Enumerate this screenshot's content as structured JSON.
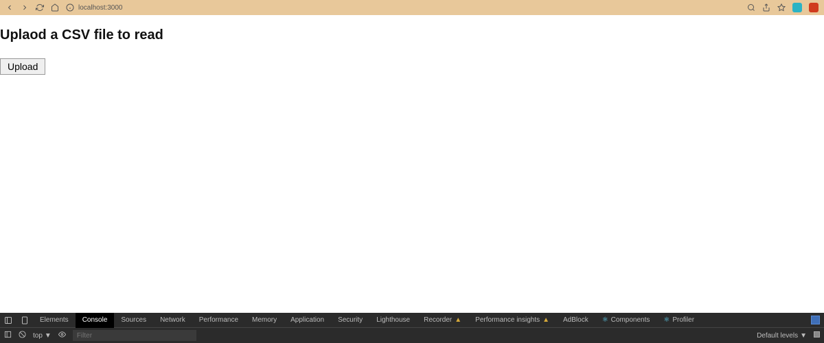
{
  "browser": {
    "url": "localhost:3000"
  },
  "page": {
    "heading": "Uplaod a CSV file to read",
    "upload_button": "Upload"
  },
  "devtools": {
    "tabs": {
      "elements": "Elements",
      "console": "Console",
      "sources": "Sources",
      "network": "Network",
      "performance": "Performance",
      "memory": "Memory",
      "application": "Application",
      "security": "Security",
      "lighthouse": "Lighthouse",
      "recorder": "Recorder",
      "performance_insights": "Performance insights",
      "adblock": "AdBlock",
      "components": "Components",
      "profiler": "Profiler"
    },
    "toolbar": {
      "context": "top",
      "filter_placeholder": "Filter",
      "levels": "Default levels"
    }
  }
}
